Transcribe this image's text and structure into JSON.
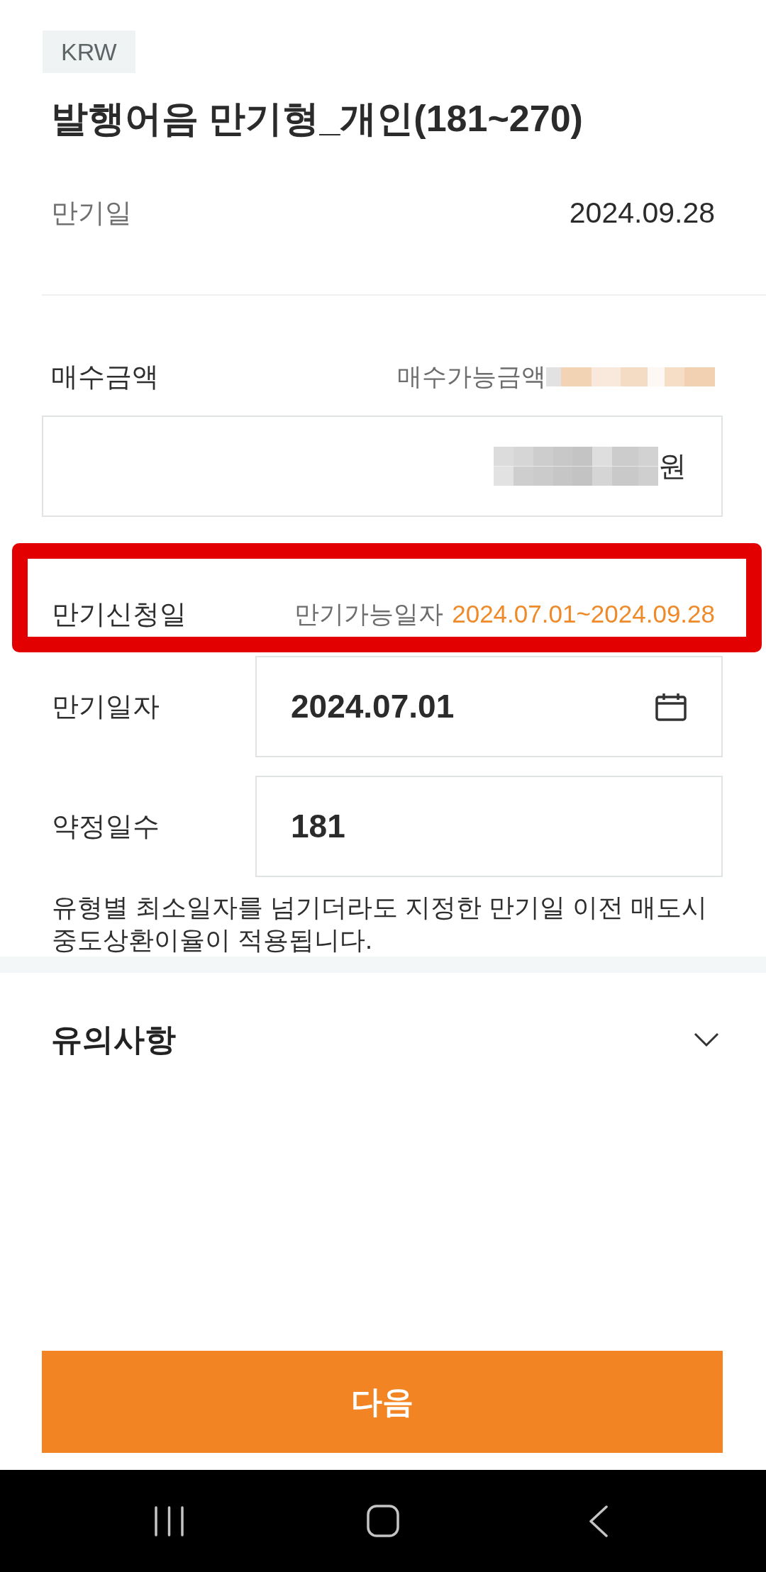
{
  "currency_tag": "KRW",
  "title": "발행어음 만기형_개인(181~270)",
  "maturity": {
    "label": "만기일",
    "value": "2024.09.28"
  },
  "purchase": {
    "label": "매수금액",
    "available_label": "매수가능금액",
    "unit": "원"
  },
  "maturity_request": {
    "label": "만기신청일",
    "range_label": "만기가능일자",
    "range": "2024.07.01~2024.09.28"
  },
  "fields": [
    {
      "kind": "date",
      "label": "만기일자",
      "value": "2024.07.01"
    },
    {
      "kind": "number",
      "label": "약정일수",
      "value": "181"
    }
  ],
  "notice": "유형별 최소일자를 넘기더라도 지정한 만기일 이전 매도시 중도상환이율이 적용됩니다.",
  "caution": {
    "title": "유의사항",
    "expanded": false
  },
  "next_button": "다음"
}
